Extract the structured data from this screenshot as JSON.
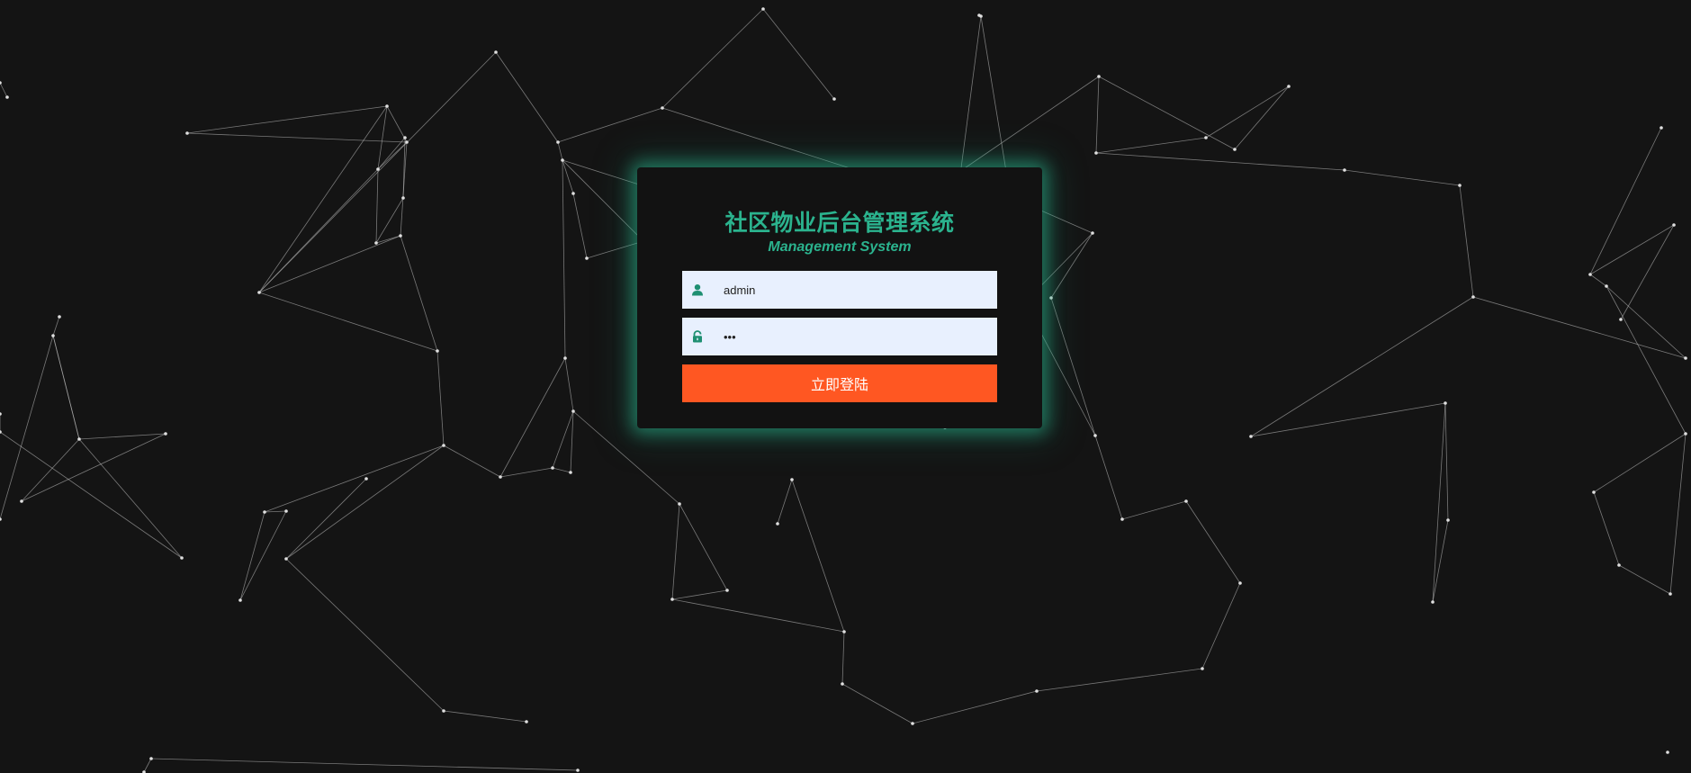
{
  "app": {
    "title_cn": "社区物业后台管理系统",
    "title_en": "Management System"
  },
  "form": {
    "username_value": "admin",
    "password_value": "123",
    "login_label": "立即登陆"
  },
  "icons": {
    "username": "user-icon",
    "password": "lock-icon"
  },
  "colors": {
    "background": "#141414",
    "accent": "#2bb38e",
    "button": "#ff5722",
    "input_bg": "#e8f0fe"
  }
}
